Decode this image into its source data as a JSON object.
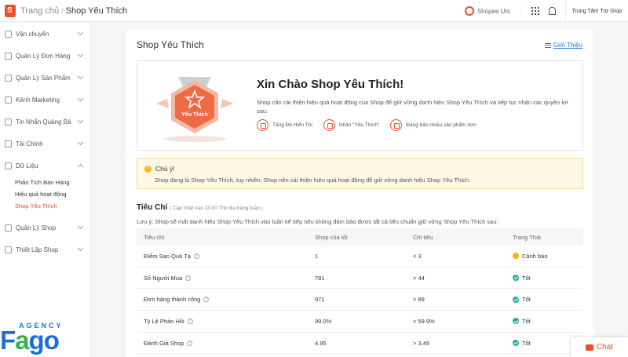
{
  "header": {
    "breadcrumb_home": "Trang chủ",
    "breadcrumb_sep": "/",
    "breadcrumb_current": "Shop Yêu Thích",
    "uni_label": "Shopee Uni",
    "help_label": "Trung Tâm Trợ Giúp"
  },
  "sidebar": {
    "items": [
      {
        "label": "Vận chuyển"
      },
      {
        "label": "Quản Lý Đơn Hàng"
      },
      {
        "label": "Quản Lý Sản Phẩm"
      },
      {
        "label": "Kênh Marketing"
      },
      {
        "label": "Tin Nhắn Quảng Bá"
      },
      {
        "label": "Tài Chính"
      },
      {
        "label": "Dữ Liệu"
      },
      {
        "label": "Quản Lý Shop"
      },
      {
        "label": "Thiết Lập Shop"
      }
    ],
    "sub_items": [
      {
        "label": "Phân Tích Bán Hàng"
      },
      {
        "label": "Hiệu quả hoạt động"
      },
      {
        "label": "Shop Yêu Thích",
        "active": true
      }
    ]
  },
  "main": {
    "title": "Shop Yêu Thích",
    "intro_link": "Giới Thiệu",
    "welcome": {
      "badge_text": "Yêu Thích",
      "title": "Xin Chào Shop Yêu Thích!",
      "text": "Shop cần cải thiện hiệu quả hoạt động của Shop để giữ vững danh hiệu Shop Yêu Thích và tiếp tục nhận các quyền lợi sau:",
      "perks": [
        {
          "label": "Tăng Độ Hiển Thị"
        },
        {
          "label": "Nhãn \"Yêu Thích\""
        },
        {
          "label": "Đăng bán nhiều sản phẩm hơn"
        }
      ]
    },
    "notice": {
      "title": "Chú ý!",
      "text": "Shop đang là Shop Yêu Thích, tuy nhiên, Shop nên cải thiện hiệu quả hoạt động để giữ vững danh hiệu Shop Yêu Thích."
    },
    "criteria": {
      "title": "Tiêu Chí",
      "note": "( Cập nhật vào 13:00 Thứ Ba hàng tuần )",
      "desc": "Lưu ý: Shop sẽ mất danh hiệu Shop Yêu Thích vào tuần kế tiếp nếu không đảm bảo được tất cả tiêu chuẩn giữ vững Shop Yêu Thích sau:"
    },
    "table": {
      "headers": [
        "Tiêu chí",
        "Shop của tôi",
        "Chỉ tiêu",
        "Trạng Thái"
      ],
      "rows": [
        {
          "criterion": "Điểm Sao Quả Tạ",
          "mine": "1",
          "target": "< 3",
          "status": "Cảnh báo",
          "status_type": "warn"
        },
        {
          "criterion": "Số Người Mua",
          "mine": "781",
          "target": "> 44",
          "status": "Tốt",
          "status_type": "ok"
        },
        {
          "criterion": "Đơn hàng thành công",
          "mine": "971",
          "target": "> 89",
          "status": "Tốt",
          "status_type": "ok"
        },
        {
          "criterion": "Tỷ Lệ Phản Hồi",
          "mine": "99.0%",
          "target": "> 59.9%",
          "status": "Tốt",
          "status_type": "ok"
        },
        {
          "criterion": "Đánh Giá Shop",
          "mine": "4.95",
          "target": "> 3.49",
          "status": "Tốt",
          "status_type": "ok"
        }
      ]
    }
  },
  "watermark": {
    "top": "AGENCY",
    "logo_f": "F",
    "logo_a": "a",
    "logo_go": "go"
  },
  "chat_label": "Chat",
  "colors": {
    "brand": "#ee4d2d",
    "link": "#2673dd",
    "ok": "#26aa99",
    "warn": "#f6b714"
  }
}
